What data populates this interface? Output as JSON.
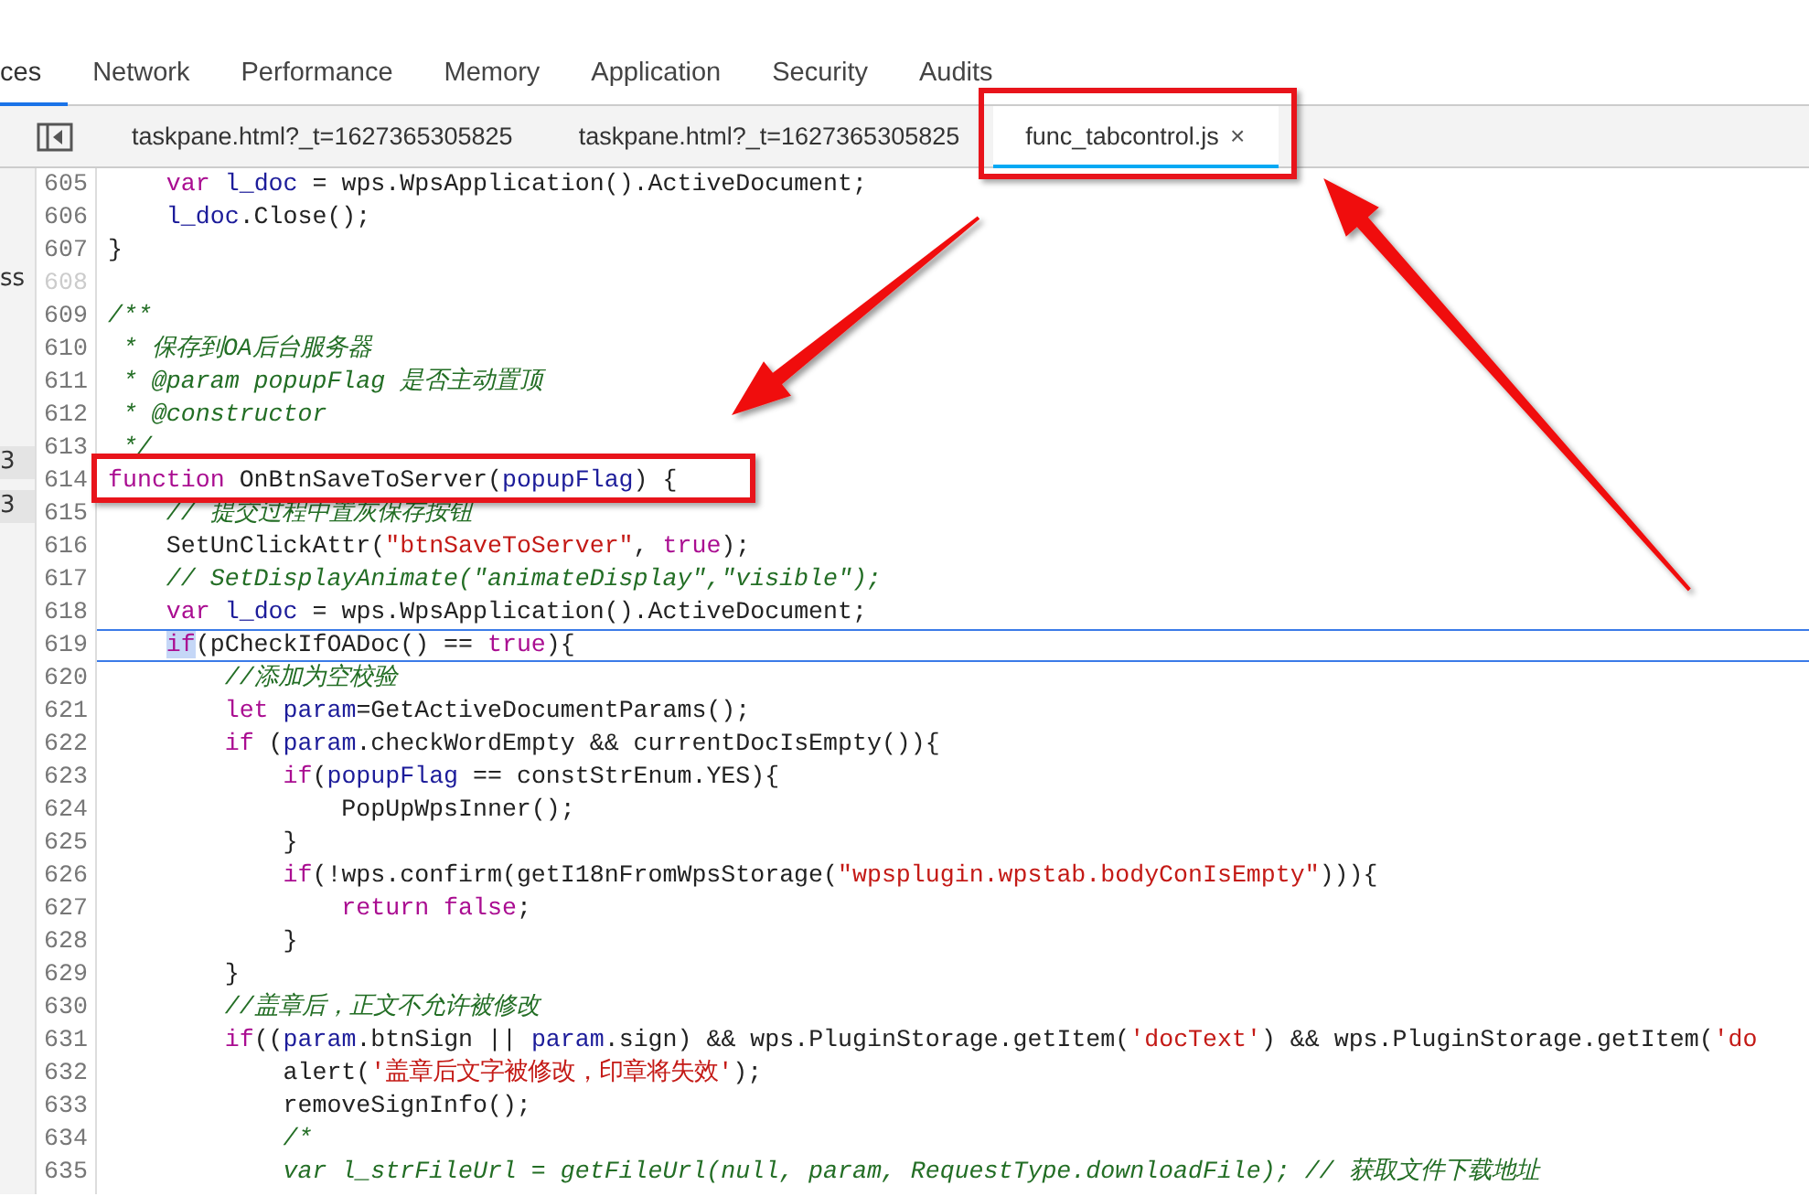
{
  "panel_tabs": [
    {
      "label": "ces",
      "selected": true
    },
    {
      "label": "Network",
      "selected": false
    },
    {
      "label": "Performance",
      "selected": false
    },
    {
      "label": "Memory",
      "selected": false
    },
    {
      "label": "Application",
      "selected": false
    },
    {
      "label": "Security",
      "selected": false
    },
    {
      "label": "Audits",
      "selected": false
    }
  ],
  "file_tabs": [
    {
      "label": "taskpane.html?_t=1627365305825",
      "selected": false,
      "closable": false,
      "annotated": false
    },
    {
      "label": "taskpane.html?_t=1627365305825",
      "selected": false,
      "closable": false,
      "annotated": false
    },
    {
      "label": "func_tabcontrol.js",
      "selected": true,
      "closable": true,
      "annotated": true,
      "close": "×"
    }
  ],
  "sidebar": {
    "items": [
      {
        "label": "ss",
        "selected": false
      },
      {
        "label": "3",
        "selected": true
      },
      {
        "label": "3",
        "selected": true
      }
    ]
  },
  "code": {
    "lines": [
      {
        "number": "605",
        "current": false,
        "annotated": false,
        "tokens": [
          {
            "t": "    var",
            "kind": "keyword"
          },
          {
            "t": " l_doc",
            "kind": "variable"
          },
          {
            "t": " = wps.WpsApplication().ActiveDocument;",
            "kind": "plain"
          }
        ]
      },
      {
        "number": "606",
        "current": false,
        "annotated": false,
        "tokens": [
          {
            "t": "    l_doc",
            "kind": "variable"
          },
          {
            "t": ".Close();",
            "kind": "plain"
          }
        ]
      },
      {
        "number": "607",
        "current": false,
        "annotated": false,
        "tokens": [
          {
            "t": "}",
            "kind": "plain"
          }
        ]
      },
      {
        "number": "608",
        "current": false,
        "annotated": false
      },
      {
        "number": "609",
        "current": false,
        "annotated": false,
        "tokens": [
          {
            "t": "/**",
            "kind": "comment"
          }
        ]
      },
      {
        "number": "610",
        "current": false,
        "annotated": false,
        "tokens": [
          {
            "t": " * 保存到OA后台服务器",
            "kind": "comment"
          }
        ]
      },
      {
        "number": "611",
        "current": false,
        "annotated": false,
        "tokens": [
          {
            "t": " * @param popupFlag 是否主动置顶",
            "kind": "comment"
          }
        ]
      },
      {
        "number": "612",
        "current": false,
        "annotated": false,
        "tokens": [
          {
            "t": " * @constructor",
            "kind": "comment"
          }
        ]
      },
      {
        "number": "613",
        "current": false,
        "annotated": false,
        "tokens": [
          {
            "t": " */",
            "kind": "comment"
          }
        ]
      },
      {
        "number": "614",
        "current": false,
        "annotated": true,
        "tokens": [
          {
            "t": "function",
            "kind": "keyword"
          },
          {
            "t": " OnBtnSaveToServer(",
            "kind": "plain"
          },
          {
            "t": "popupFlag",
            "kind": "variable"
          },
          {
            "t": ") {",
            "kind": "plain"
          }
        ]
      },
      {
        "number": "615",
        "current": false,
        "annotated": false,
        "tokens": [
          {
            "t": "    // 提交过程中置灰保存按钮",
            "kind": "comment"
          }
        ]
      },
      {
        "number": "616",
        "current": false,
        "annotated": false,
        "tokens": [
          {
            "t": "    SetUnClickAttr(",
            "kind": "plain"
          },
          {
            "t": "\"btnSaveToServer\"",
            "kind": "string"
          },
          {
            "t": ",",
            "kind": "plain"
          },
          {
            "t": " true",
            "kind": "keyword"
          },
          {
            "t": ");",
            "kind": "plain"
          }
        ]
      },
      {
        "number": "617",
        "current": false,
        "annotated": false,
        "tokens": [
          {
            "t": "    // SetDisplayAnimate(\"animateDisplay\",\"visible\");",
            "kind": "comment"
          }
        ]
      },
      {
        "number": "618",
        "current": false,
        "annotated": false,
        "tokens": [
          {
            "t": "    var",
            "kind": "keyword"
          },
          {
            "t": " l_doc",
            "kind": "variable"
          },
          {
            "t": " = wps.WpsApplication().ActiveDocument;",
            "kind": "plain"
          }
        ]
      },
      {
        "number": "619",
        "current": true,
        "annotated": false,
        "tokens": [
          {
            "t": "    if",
            "kind": "keyword-selected"
          },
          {
            "t": "(pCheckIfOADoc() ==",
            "kind": "plain"
          },
          {
            "t": " true",
            "kind": "keyword"
          },
          {
            "t": "){",
            "kind": "plain"
          }
        ]
      },
      {
        "number": "620",
        "current": false,
        "annotated": false,
        "tokens": [
          {
            "t": "        //添加为空校验",
            "kind": "comment"
          }
        ]
      },
      {
        "number": "621",
        "current": false,
        "annotated": false,
        "tokens": [
          {
            "t": "        let",
            "kind": "keyword"
          },
          {
            "t": " param",
            "kind": "variable"
          },
          {
            "t": "=GetActiveDocumentParams();",
            "kind": "plain"
          }
        ]
      },
      {
        "number": "622",
        "current": false,
        "annotated": false,
        "tokens": [
          {
            "t": "        if",
            "kind": "keyword"
          },
          {
            "t": " (",
            "kind": "plain"
          },
          {
            "t": "param",
            "kind": "variable"
          },
          {
            "t": ".checkWordEmpty && currentDocIsEmpty()){",
            "kind": "plain"
          }
        ]
      },
      {
        "number": "623",
        "current": false,
        "annotated": false,
        "tokens": [
          {
            "t": "            if",
            "kind": "keyword"
          },
          {
            "t": "(",
            "kind": "plain"
          },
          {
            "t": "popupFlag",
            "kind": "variable"
          },
          {
            "t": " == constStrEnum.YES){",
            "kind": "plain"
          }
        ]
      },
      {
        "number": "624",
        "current": false,
        "annotated": false,
        "tokens": [
          {
            "t": "                PopUpWpsInner();",
            "kind": "plain"
          }
        ]
      },
      {
        "number": "625",
        "current": false,
        "annotated": false,
        "tokens": [
          {
            "t": "            }",
            "kind": "plain"
          }
        ]
      },
      {
        "number": "626",
        "current": false,
        "annotated": false,
        "tokens": [
          {
            "t": "            if",
            "kind": "keyword"
          },
          {
            "t": "(!wps.confirm(getI18nFromWpsStorage(",
            "kind": "plain"
          },
          {
            "t": "\"wpsplugin.wpstab.bodyConIsEmpty\"",
            "kind": "string"
          },
          {
            "t": "))){",
            "kind": "plain"
          }
        ]
      },
      {
        "number": "627",
        "current": false,
        "annotated": false,
        "tokens": [
          {
            "t": "                return",
            "kind": "keyword"
          },
          {
            "t": " false",
            "kind": "keyword"
          },
          {
            "t": ";",
            "kind": "plain"
          }
        ]
      },
      {
        "number": "628",
        "current": false,
        "annotated": false,
        "tokens": [
          {
            "t": "            }",
            "kind": "plain"
          }
        ]
      },
      {
        "number": "629",
        "current": false,
        "annotated": false,
        "tokens": [
          {
            "t": "        }",
            "kind": "plain"
          }
        ]
      },
      {
        "number": "630",
        "current": false,
        "annotated": false,
        "tokens": [
          {
            "t": "        //盖章后，正文不允许被修改",
            "kind": "comment"
          }
        ]
      },
      {
        "number": "631",
        "current": false,
        "annotated": false,
        "tokens": [
          {
            "t": "        if",
            "kind": "keyword"
          },
          {
            "t": "((",
            "kind": "plain"
          },
          {
            "t": "param",
            "kind": "variable"
          },
          {
            "t": ".btnSign ||",
            "kind": "plain"
          },
          {
            "t": " param",
            "kind": "variable"
          },
          {
            "t": ".sign) && wps.PluginStorage.getItem(",
            "kind": "plain"
          },
          {
            "t": "'docText'",
            "kind": "string"
          },
          {
            "t": ") && wps.PluginStorage.getItem(",
            "kind": "plain"
          },
          {
            "t": "'do",
            "kind": "string"
          }
        ]
      },
      {
        "number": "632",
        "current": false,
        "annotated": false,
        "tokens": [
          {
            "t": "            alert(",
            "kind": "plain"
          },
          {
            "t": "'盖章后文字被修改，印章将失效'",
            "kind": "string"
          },
          {
            "t": ");",
            "kind": "plain"
          }
        ]
      },
      {
        "number": "633",
        "current": false,
        "annotated": false,
        "tokens": [
          {
            "t": "            removeSignInfo();",
            "kind": "plain"
          }
        ]
      },
      {
        "number": "634",
        "current": false,
        "annotated": false,
        "tokens": [
          {
            "t": "            /*",
            "kind": "comment"
          }
        ]
      },
      {
        "number": "635",
        "current": false,
        "annotated": false,
        "tokens": [
          {
            "t": "            var l_strFileUrl = getFileUrl(null, param, RequestType.downloadFile); // 获取文件下载地址",
            "kind": "comment"
          }
        ]
      }
    ]
  }
}
